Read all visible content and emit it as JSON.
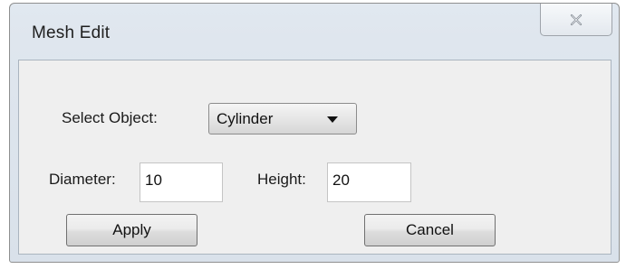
{
  "window": {
    "title": "Mesh Edit",
    "close_icon": "close-x-icon"
  },
  "form": {
    "select_object_label": "Select Object:",
    "select_object_value": "Cylinder",
    "dropdown_icon": "chevron-down-icon",
    "diameter_label": "Diameter:",
    "diameter_value": "10",
    "height_label": "Height:",
    "height_value": "20"
  },
  "buttons": {
    "apply_label": "Apply",
    "cancel_label": "Cancel"
  }
}
